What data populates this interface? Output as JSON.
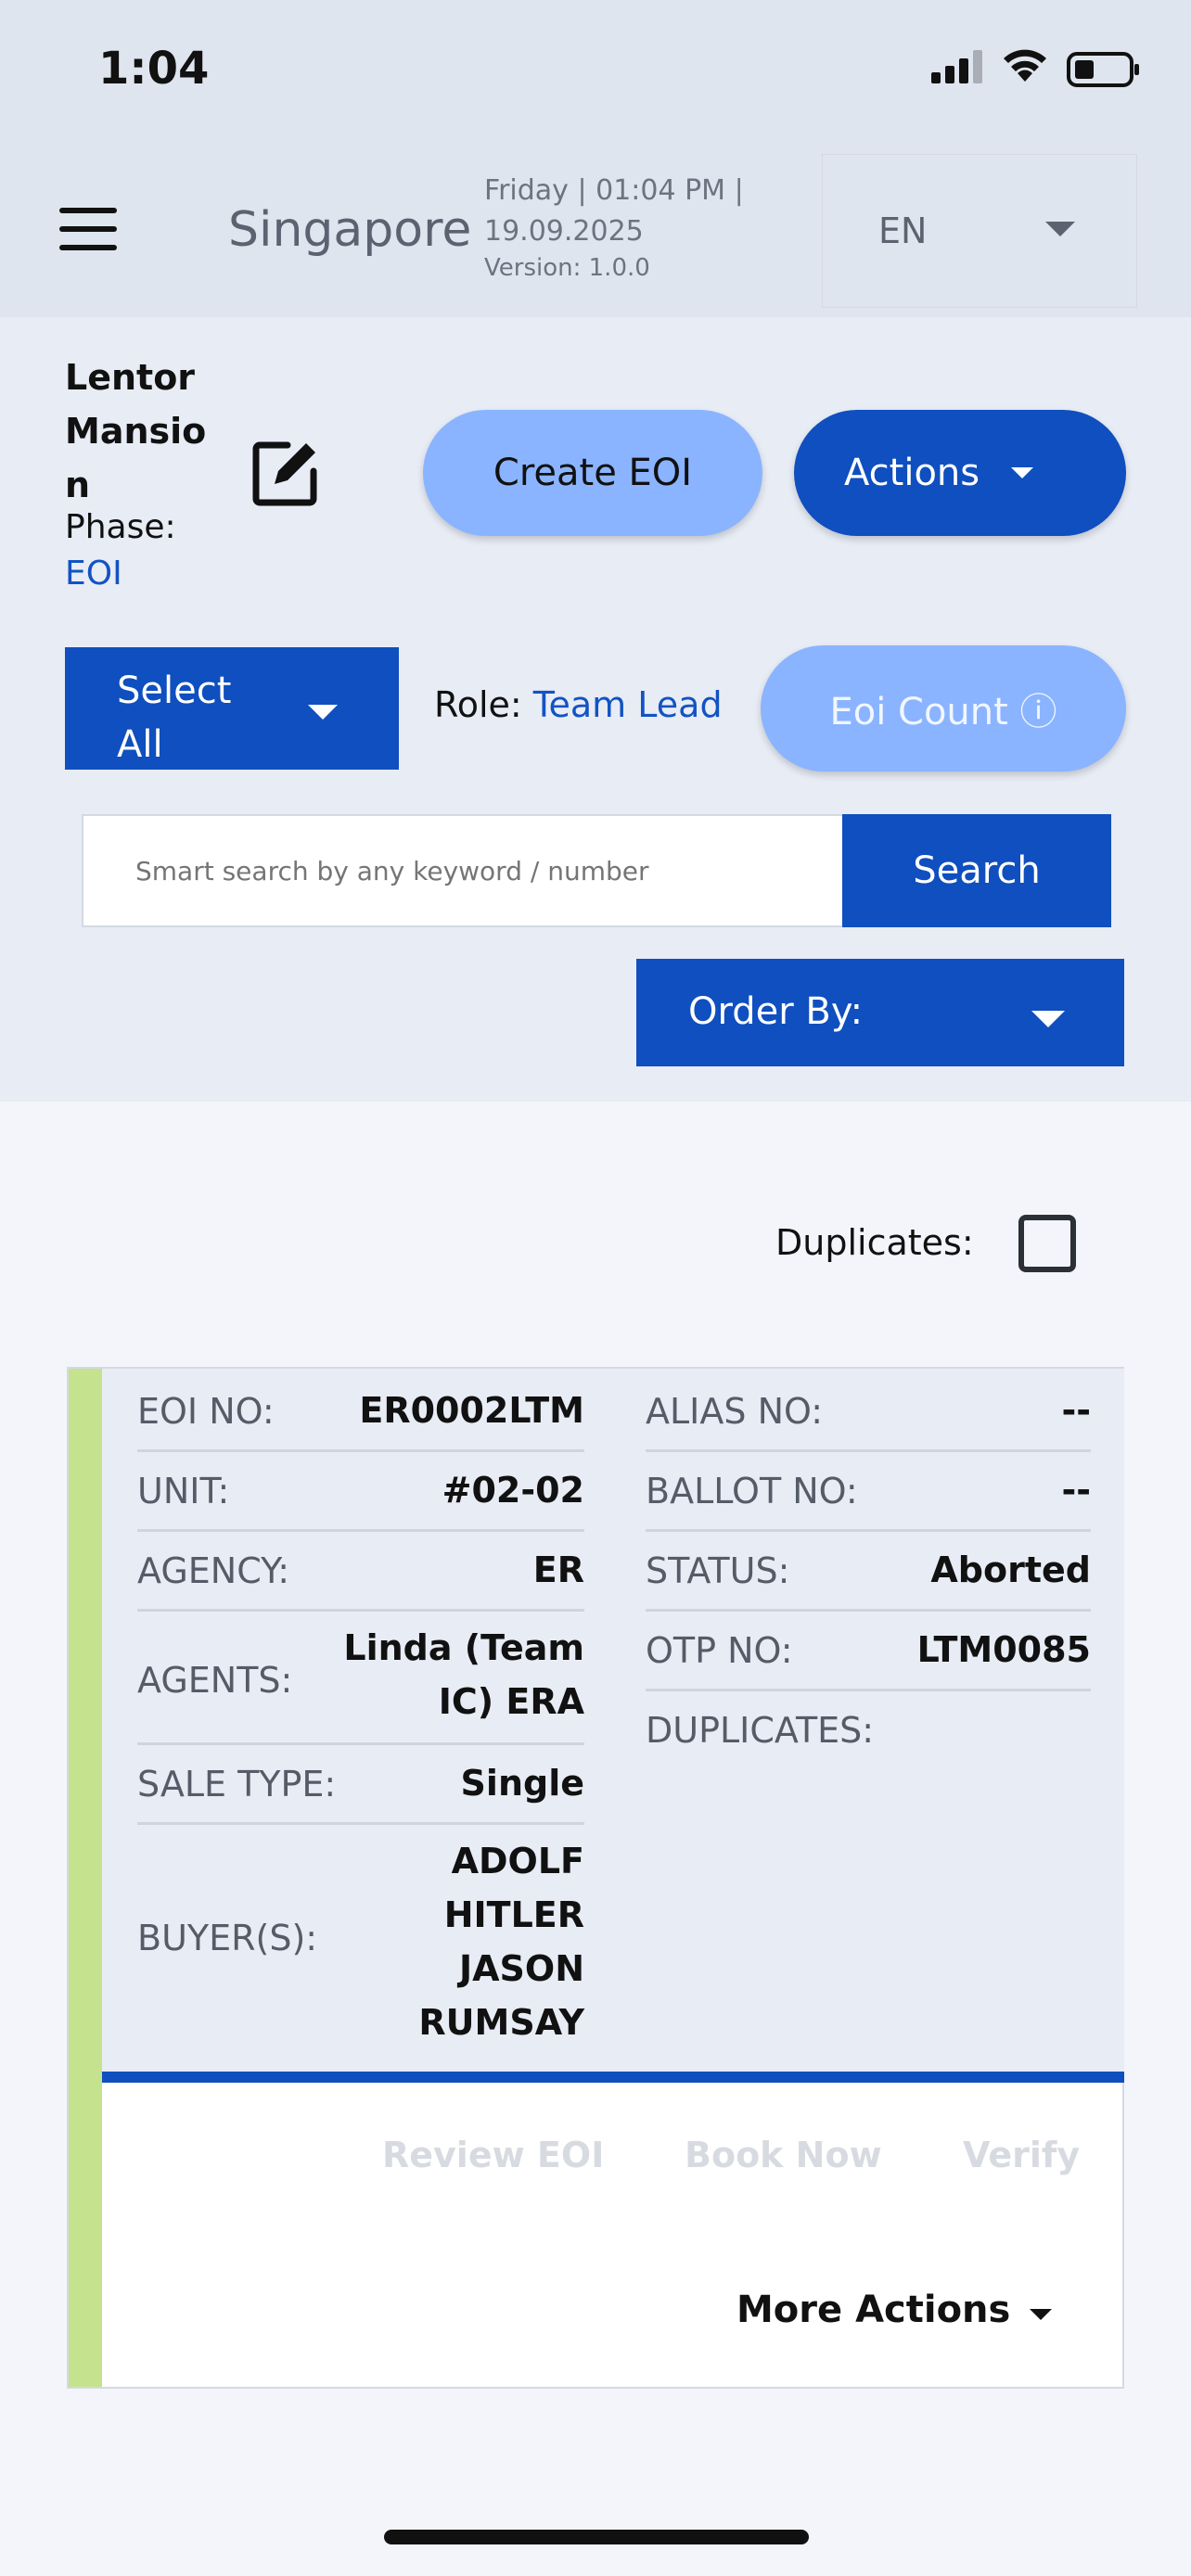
{
  "status_bar": {
    "time": "1:04"
  },
  "header": {
    "country": "Singapore",
    "datetime_line1": "Friday | 01:04 PM |",
    "datetime_line2": "19.09.2025",
    "version": "Version: 1.0.0",
    "language": "EN"
  },
  "project": {
    "name": "Lentor Mansion",
    "phase_label": "Phase:",
    "phase_value": "EOI"
  },
  "buttons": {
    "create_eoi": "Create EOI",
    "actions": "Actions",
    "select_all": "Select All",
    "eoi_count": "Eoi Count ⓘ",
    "search": "Search",
    "order_by": "Order By:"
  },
  "role": {
    "label": "Role: ",
    "value": "Team Lead"
  },
  "search": {
    "placeholder": "Smart search by any keyword / number"
  },
  "duplicates": {
    "label": "Duplicates:"
  },
  "card": {
    "left": [
      {
        "label": "EOI NO:",
        "value": "ER0002LTM"
      },
      {
        "label": "UNIT:",
        "value": "#02-02"
      },
      {
        "label": "AGENCY:",
        "value": "ER"
      },
      {
        "label": "AGENTS:",
        "value": "Linda (Team IC) ERA"
      },
      {
        "label": "SALE TYPE:",
        "value": "Single"
      },
      {
        "label": "BUYER(S):",
        "value": "ADOLF HITLER JASON RUMSAY"
      }
    ],
    "right": [
      {
        "label": "ALIAS NO:",
        "value": "--"
      },
      {
        "label": "BALLOT NO:",
        "value": "--"
      },
      {
        "label": "STATUS:",
        "value": "Aborted"
      },
      {
        "label": "OTP NO:",
        "value": "LTM0085"
      },
      {
        "label": "DUPLICATES:",
        "value": ""
      }
    ],
    "actions": {
      "review": "Review EOI",
      "book": "Book Now",
      "verify": "Verify",
      "more": "More Actions"
    }
  },
  "colors": {
    "primary": "#0f4fbf",
    "light_button": "#8ab4ff",
    "card_stripe": "#c5e28e",
    "link": "#1253c3"
  }
}
